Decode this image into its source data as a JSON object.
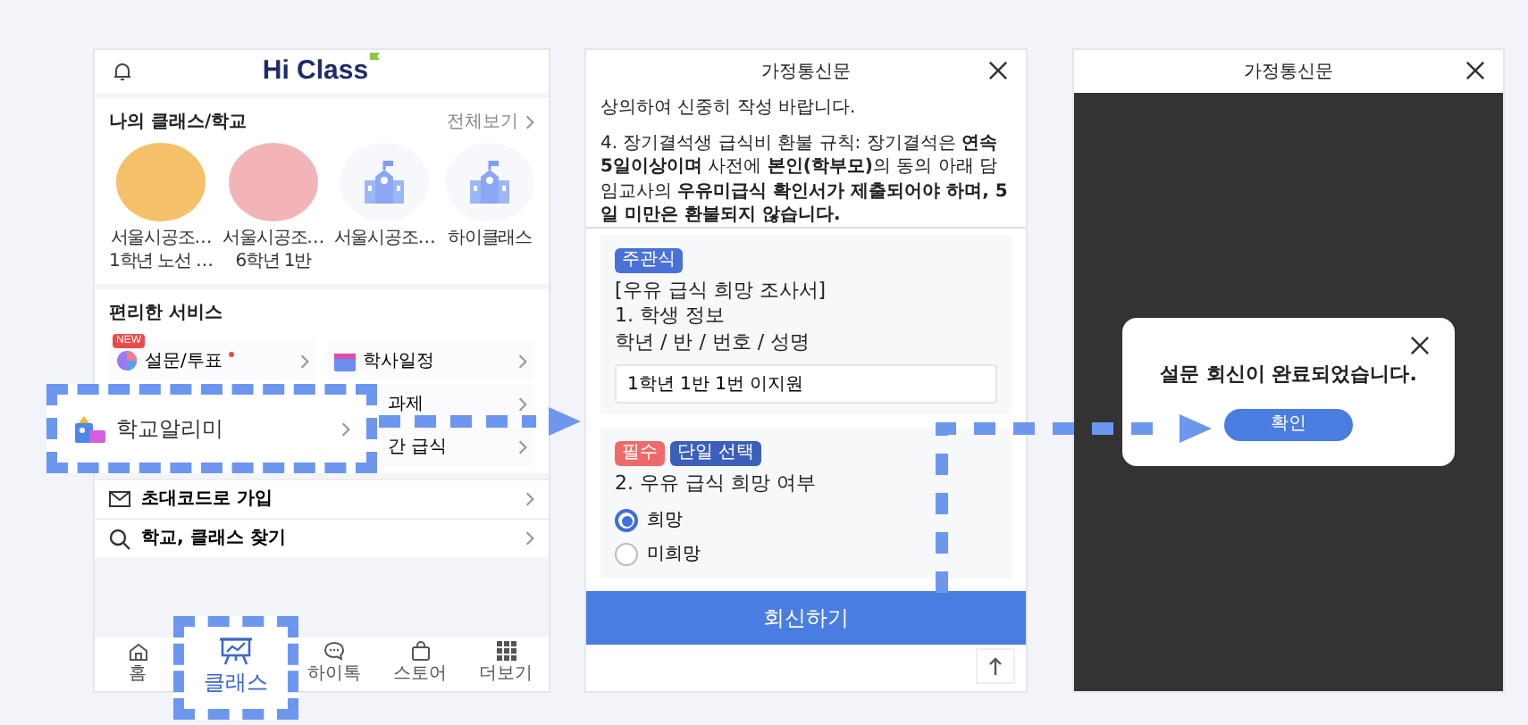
{
  "home_screen": {
    "logo": "Hi Class",
    "my_classes": {
      "title": "나의 클래스/학교",
      "view_all": "전체보기",
      "items": [
        {
          "kind": "illustration",
          "lines": [
            "서울시공조…",
            "1학년 노선 …"
          ]
        },
        {
          "kind": "illustration",
          "lines": [
            "서울시공조…",
            "6학년 1반"
          ]
        },
        {
          "kind": "school",
          "lines": [
            "서울시공조…"
          ]
        },
        {
          "kind": "school",
          "lines": [
            "하이클래스"
          ]
        }
      ]
    },
    "services": {
      "title": "편리한 서비스",
      "rows": [
        {
          "left": {
            "kind": "survey",
            "label": "설문/투표",
            "badge": "NEW",
            "dot": true
          },
          "right": {
            "kind": "calendar",
            "label": "학사일정"
          }
        },
        {
          "right": {
            "label": "과제"
          }
        },
        {
          "right": {
            "label": "간 급식"
          }
        }
      ],
      "callout": {
        "label": "학교알리미"
      }
    },
    "links": [
      {
        "kind": "mail",
        "label": "초대코드로 가입"
      },
      {
        "kind": "search",
        "label": "학교, 클래스 찾기"
      }
    ],
    "nav": [
      {
        "kind": "home",
        "label": "홈",
        "selected": false
      },
      {
        "kind": "class",
        "label": "클래스",
        "selected": true
      },
      {
        "kind": "chat",
        "label": "하이톡",
        "selected": false
      },
      {
        "kind": "store",
        "label": "스토어",
        "selected": false
      },
      {
        "kind": "more",
        "label": "더보기",
        "selected": false
      }
    ]
  },
  "survey_screen": {
    "title": "가정통신문",
    "notice": [
      "상의하여 신중히 작성 바랍니다.",
      "4. 장기결석생 급식비 환불 규칙: 장기결석은 **연속 5일이상이며** 사전에 **본인(학부모)**의 동의 아래 담임교사의 **우유미급식 확인서가 제출되어야 하며, 5일 미만은 환불되지 않습니다.**"
    ],
    "questions": [
      {
        "kind": "text",
        "tags": [
          {
            "label": "주관식",
            "color": "#4a72d6"
          }
        ],
        "title_lines": [
          "[우유 급식 희망 조사서]",
          "1. 학생 정보",
          "학년 / 반 / 번호 / 성명"
        ],
        "value": "1학년 1반 1번 이지원"
      },
      {
        "kind": "radio",
        "tags": [
          {
            "label": "필수",
            "color": "#ee6a6a"
          },
          {
            "label": "단일 선택",
            "color": "#3b5fba"
          }
        ],
        "title_lines": [
          "2. 우유 급식 희망 여부"
        ],
        "options": [
          {
            "label": "희망",
            "selected": true
          },
          {
            "label": "미희망",
            "selected": false
          }
        ]
      }
    ],
    "submit": "회신하기"
  },
  "completion_screen": {
    "title": "가정통신문",
    "dialog": {
      "message": "설문 회신이 완료되었습니다.",
      "button": "확인"
    }
  }
}
